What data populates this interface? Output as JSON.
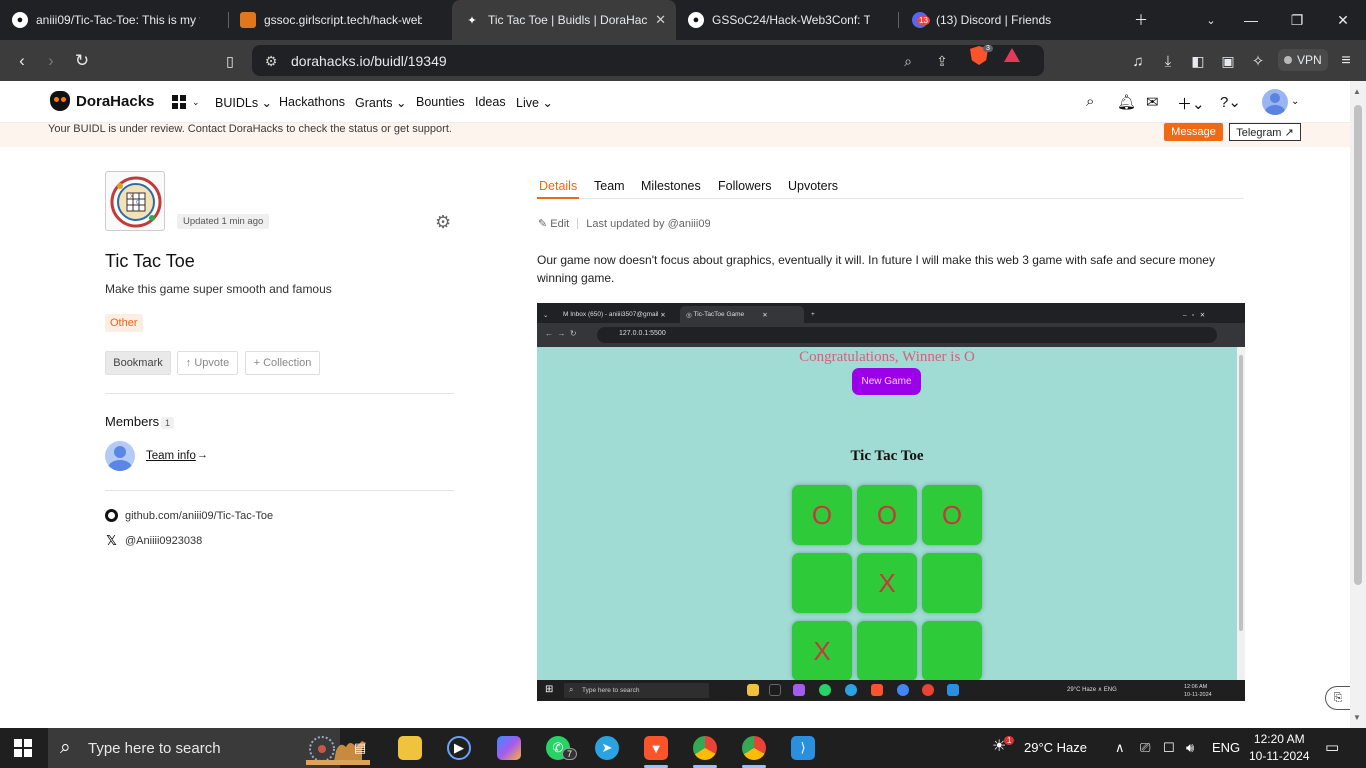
{
  "browser": {
    "tabs": [
      {
        "title": "aniii09/Tic-Tac-Toe: This is my firs",
        "favicon": "github-icon",
        "active": false
      },
      {
        "title": "gssoc.girlscript.tech/hack-web3",
        "favicon": "metamask-fox-icon",
        "active": false
      },
      {
        "title": "Tic Tac Toe | Buidls | DoraHac",
        "favicon": "dorahacks-icon",
        "active": true
      },
      {
        "title": "GSSoC24/Hack-Web3Conf: This i",
        "favicon": "github-icon",
        "active": false
      },
      {
        "title": "(13) Discord | Friends",
        "favicon": "discord-icon",
        "active": false,
        "badge": "13"
      }
    ],
    "url": "dorahacks.io/buidl/19349",
    "brave_shield_count": "3",
    "vpn_label": "VPN"
  },
  "site": {
    "brand": "DoraHacks",
    "nav": [
      "BUIDLs",
      "Hackathons",
      "Grants",
      "Bounties",
      "Ideas",
      "Live"
    ],
    "banner_text": "Your BUIDL is under review. Contact DoraHacks to check the status or get support.",
    "message_label": "Message",
    "telegram_label": "Telegram ↗"
  },
  "project": {
    "updated": "Updated 1 min ago",
    "title": "Tic Tac Toe",
    "tagline": "Make this game super smooth and famous",
    "tag": "Other",
    "bookmark_label": "Bookmark",
    "upvote_label": "↑ Upvote",
    "collection_label": "+ Collection",
    "members_label": "Members",
    "members_count": "1",
    "team_info_label": "Team info",
    "team_info_arrow": "→",
    "github_link": "github.com/aniii09/Tic-Tac-Toe",
    "x_handle": "@Aniiii0923038"
  },
  "details": {
    "tabs": [
      "Details",
      "Team",
      "Milestones",
      "Followers",
      "Upvoters"
    ],
    "edit_label": "Edit",
    "last_updated": "Last updated by @aniii09",
    "description": "Our game now doesn't focus about graphics, eventually it will. In future I will make this web 3 game with safe and secure money winning game."
  },
  "screenshot": {
    "tab1": "Inbox (650) - aniiii3507@gmail",
    "tab2": "Tic-TacToe Game",
    "url": "127.0.0.1:5500",
    "congrats": "Congratulations, Winner is O",
    "new_game": "New Game",
    "game_title": "Tic Tac Toe",
    "board": [
      "O",
      "O",
      "O",
      "",
      "X",
      "",
      "X",
      "",
      ""
    ],
    "search_placeholder": "Type here to search",
    "tray_text": "29°C  Haze  ∧  ENG",
    "clock_time": "12:06 AM",
    "clock_date": "10-11-2024"
  },
  "taskbar": {
    "search_placeholder": "Type here to search",
    "whatsapp_badge": "7",
    "weather_badge": "1",
    "weather": "29°C  Haze",
    "lang": "ENG",
    "time": "12:20 AM",
    "date": "10-11-2024"
  },
  "colors": {
    "accent": "#ea6a18",
    "game_bg": "#a0dbd4",
    "cell": "#2fca3a",
    "new_game": "#9b00e8"
  }
}
